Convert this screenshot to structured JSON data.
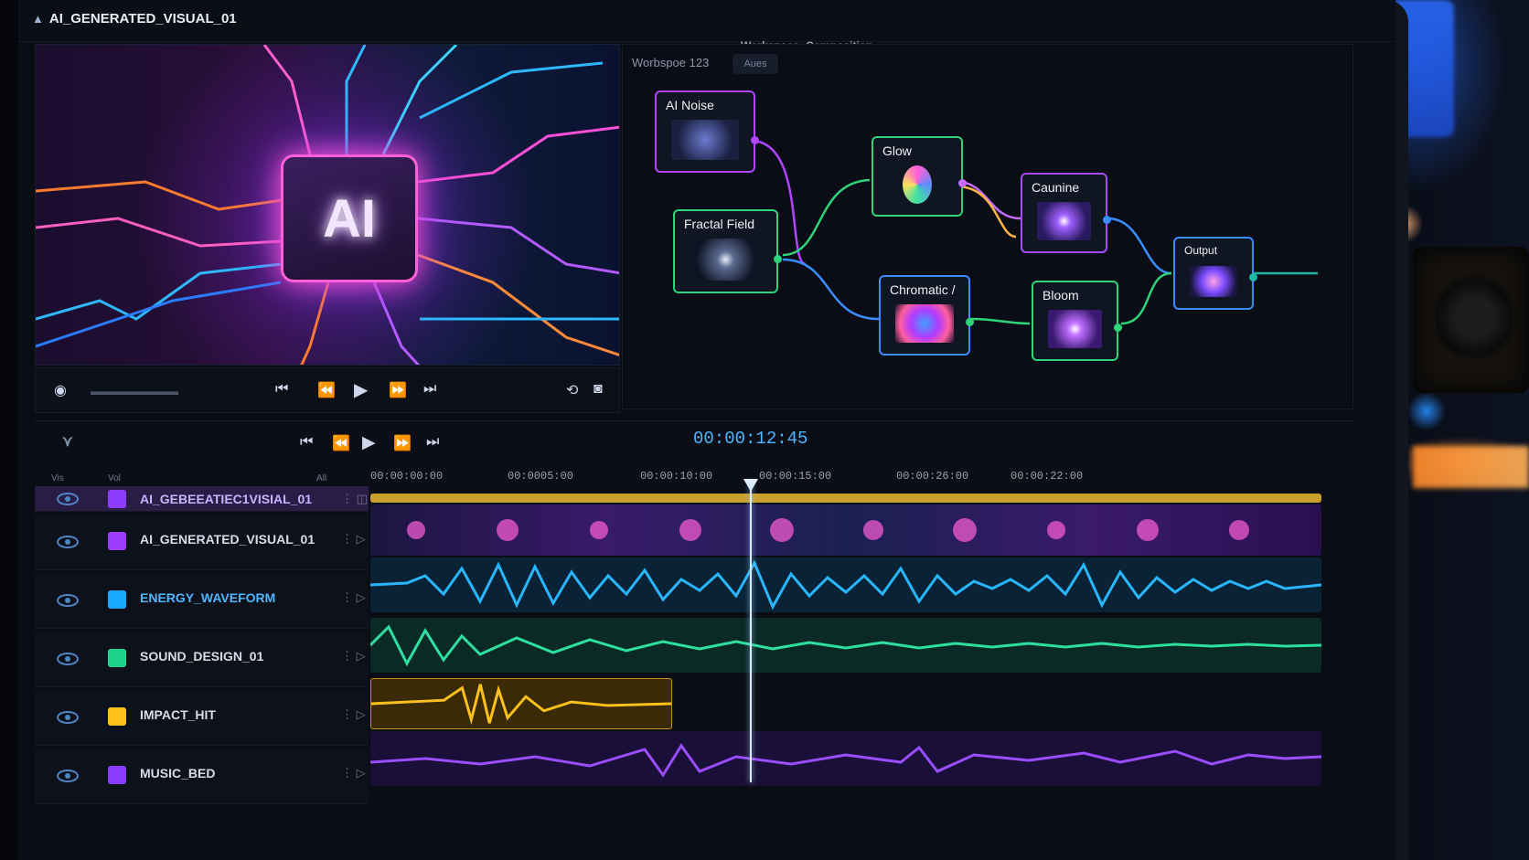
{
  "app": {
    "title": "AI_GENERATED_VISUAL_01",
    "workspace_label": "Workspace: Composition"
  },
  "preview": {
    "chip_text": "AI"
  },
  "graph": {
    "tab_label": "Worbspoe 123",
    "tab2_label": "Aues",
    "nodes": [
      {
        "label": "AI Noise",
        "color": "#c04bff"
      },
      {
        "label": "Fractal Field",
        "color": "#3ddc7a"
      },
      {
        "label": "Glow",
        "color": "#2fd37a"
      },
      {
        "label": "Chromatic /",
        "color": "#3a8dff"
      },
      {
        "label": "Caunine",
        "color": "#a64bff"
      },
      {
        "label": "Bloom",
        "color": "#2fd37a"
      },
      {
        "label": "Output",
        "color": "#3a8dff"
      }
    ]
  },
  "timeline": {
    "timecode": "00:00:12:45",
    "ruler": [
      "00:00:00:00",
      "00:0005:00",
      "00:00:10:00",
      "00:00:15:00",
      "00:00:26:00",
      "00:00:22:00"
    ],
    "columns": [
      "Vis",
      "Vol",
      "All"
    ]
  },
  "tracks": [
    {
      "name": "AI_GEBEEATIEC1VISIAL_01",
      "color": "#8a3dff"
    },
    {
      "name": "AI_GENERATED_VISUAL_01",
      "color": "#9b3dff"
    },
    {
      "name": "ENERGY_WAVEFORM",
      "color": "#19a9ff"
    },
    {
      "name": "SOUND_DESIGN_01",
      "color": "#1fd18a"
    },
    {
      "name": "IMPACT_HIT",
      "color": "#ffc21a"
    },
    {
      "name": "MUSIC_BED",
      "color": "#8a3dff"
    }
  ]
}
